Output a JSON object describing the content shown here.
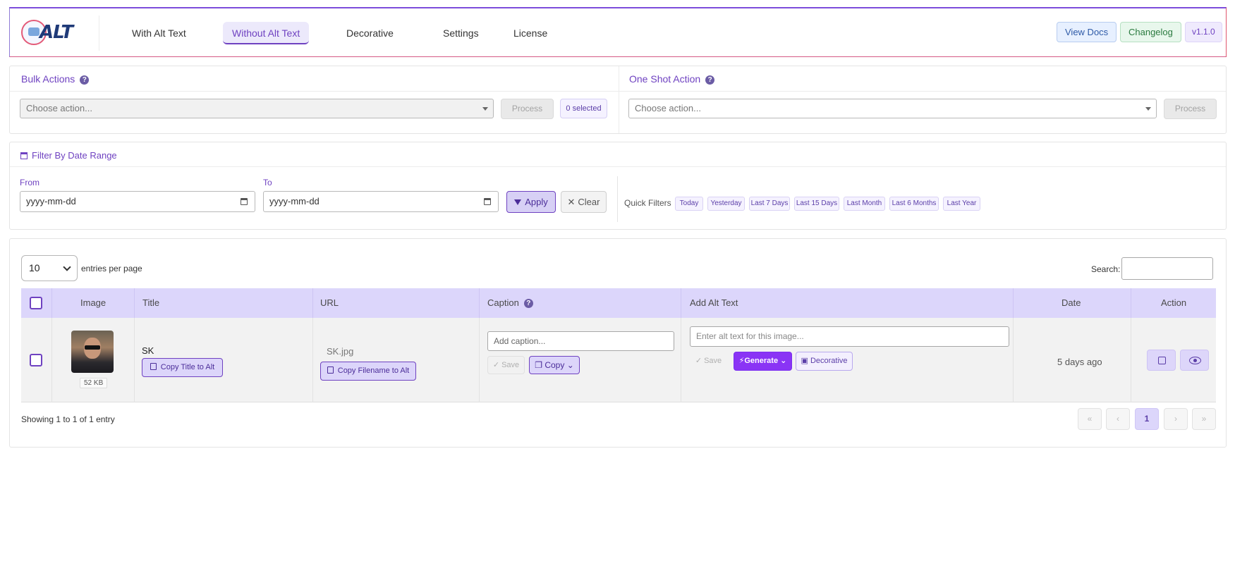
{
  "nav": {
    "logo_text": "ALT",
    "tabs": [
      {
        "label": "With Alt Text"
      },
      {
        "label": "Without Alt Text"
      },
      {
        "label": "Decorative"
      },
      {
        "label": "Settings"
      },
      {
        "label": "License"
      }
    ],
    "view_docs": "View Docs",
    "changelog": "Changelog",
    "version": "v1.1.0"
  },
  "bulk": {
    "title": "Bulk Actions",
    "select_placeholder": "Choose action...",
    "process": "Process",
    "selected": "0 selected"
  },
  "oneshot": {
    "title": "One Shot Action",
    "select_placeholder": "Choose action...",
    "process": "Process"
  },
  "filter": {
    "title": "Filter By Date Range",
    "from_label": "From",
    "to_label": "To",
    "from_value": "yyyy-mm-dd",
    "to_value": "yyyy-mm-dd",
    "apply": "Apply",
    "clear": "Clear",
    "quick_label": "Quick Filters",
    "quick": [
      "Today",
      "Yesterday",
      "Last 7 Days",
      "Last 15 Days",
      "Last Month",
      "Last 6 Months",
      "Last Year"
    ]
  },
  "table": {
    "per_page_value": "10",
    "per_page_label": "entries per page",
    "search_label": "Search:",
    "headers": {
      "image": "Image",
      "title": "Title",
      "url": "URL",
      "caption": "Caption",
      "alt": "Add Alt Text",
      "date": "Date",
      "action": "Action"
    },
    "row": {
      "size": "52 KB",
      "title": "SK",
      "copy_title": "Copy Title to Alt",
      "url": "SK.jpg",
      "copy_filename": "Copy Filename to Alt",
      "caption_placeholder": "Add caption...",
      "save": "Save",
      "copy": "Copy",
      "alt_placeholder": "Enter alt text for this image...",
      "generate": "Generate",
      "decorative": "Decorative",
      "date": "5 days ago"
    },
    "info": "Showing 1 to 1 of 1 entry",
    "pagination": {
      "first": "«",
      "prev": "‹",
      "current": "1",
      "next": "›",
      "last": "»"
    }
  },
  "colors": {
    "accent": "#6f42c1",
    "header_bg": "#dcd6fb",
    "generate": "#8a34f5"
  }
}
